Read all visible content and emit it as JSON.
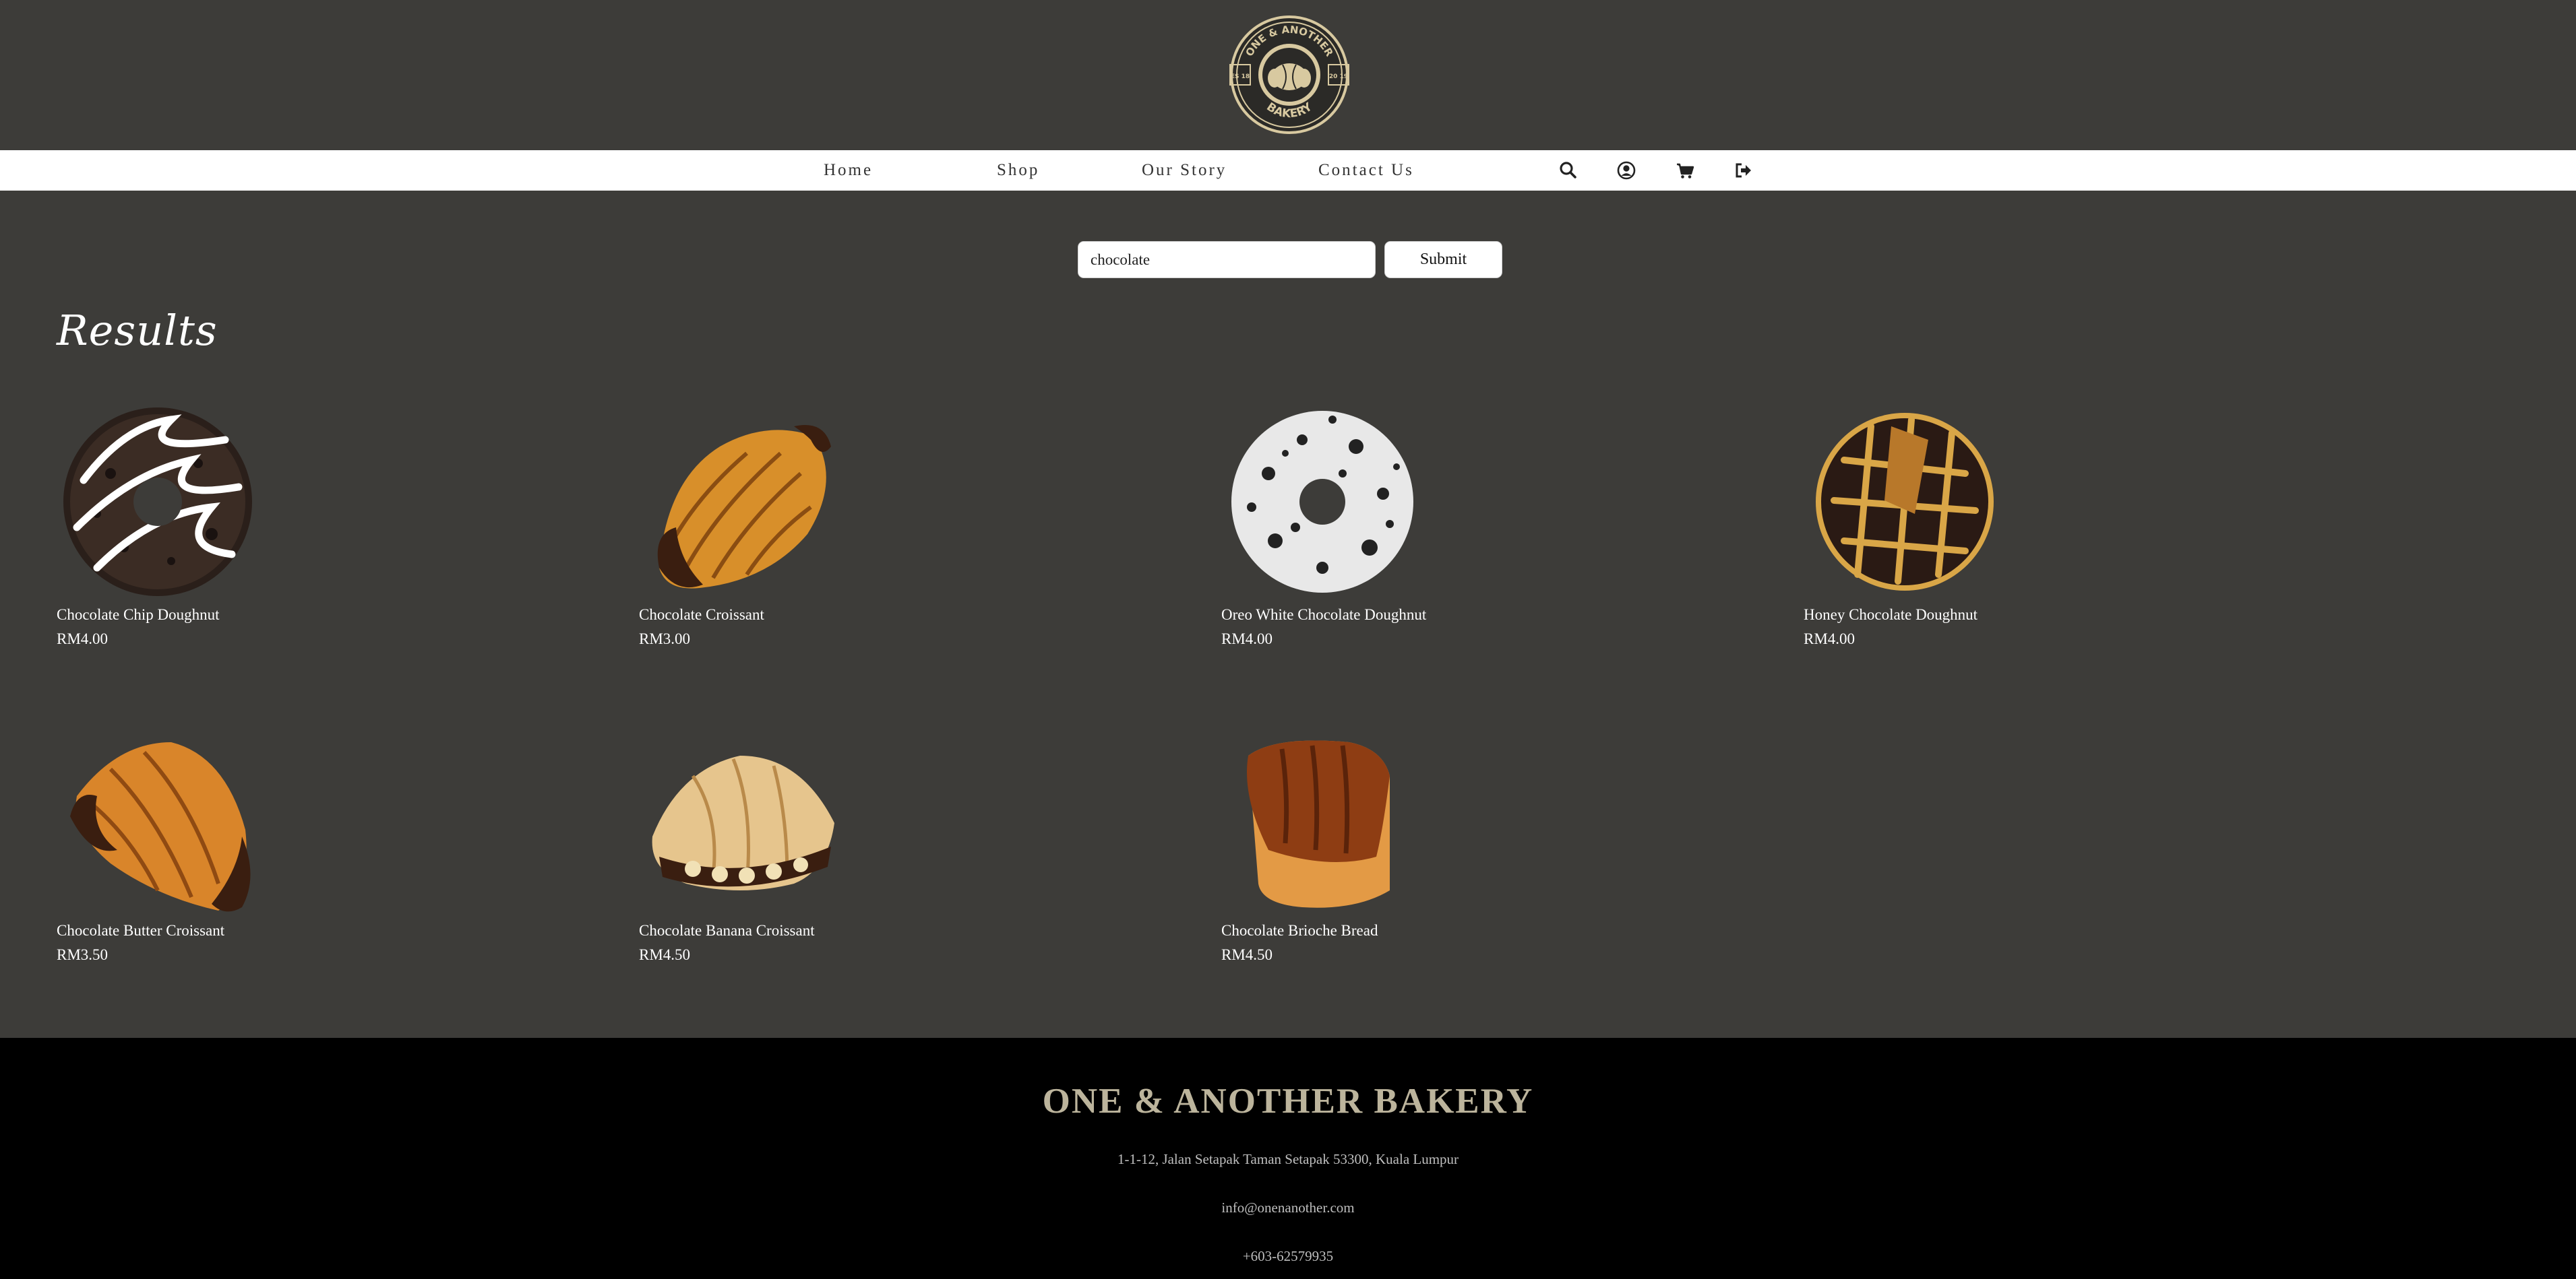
{
  "brand": {
    "logo_top_text": "ONE & ANOTHER",
    "logo_bottom_text": "BAKERY",
    "logo_left_text": "ES 18",
    "logo_right_text": "20 19"
  },
  "nav": {
    "home": "Home",
    "shop": "Shop",
    "story": "Our Story",
    "contact": "Contact Us"
  },
  "icons": [
    "search-icon",
    "account-icon",
    "cart-icon",
    "logout-icon"
  ],
  "search": {
    "value": "chocolate",
    "submit_label": "Submit"
  },
  "results_heading": "Results",
  "products": [
    {
      "name": "Chocolate Chip Doughnut",
      "price": "RM4.00",
      "image": "chocolate-chip-doughnut"
    },
    {
      "name": "Chocolate Croissant",
      "price": "RM3.00",
      "image": "chocolate-croissant"
    },
    {
      "name": "Oreo White Chocolate Doughnut",
      "price": "RM4.00",
      "image": "oreo-white-chocolate-doughnut"
    },
    {
      "name": "Honey Chocolate Doughnut",
      "price": "RM4.00",
      "image": "honey-chocolate-doughnut"
    },
    {
      "name": "Chocolate Butter Croissant",
      "price": "RM3.50",
      "image": "chocolate-butter-croissant"
    },
    {
      "name": "Chocolate Banana Croissant",
      "price": "RM4.50",
      "image": "chocolate-banana-croissant"
    },
    {
      "name": "Chocolate Brioche Bread",
      "price": "RM4.50",
      "image": "chocolate-brioche-bread"
    }
  ],
  "footer": {
    "title": "ONE & ANOTHER BAKERY",
    "address": "1-1-12, Jalan Setapak Taman Setapak 53300, Kuala Lumpur",
    "email": "info@onenanother.com",
    "phone": "+603-62579935"
  },
  "colors": {
    "page_bg": "#3d3c39",
    "nav_bg": "#ffffff",
    "footer_bg": "#000000",
    "footer_title": "#bcb49c",
    "logo_gold": "#d8c9a0"
  }
}
